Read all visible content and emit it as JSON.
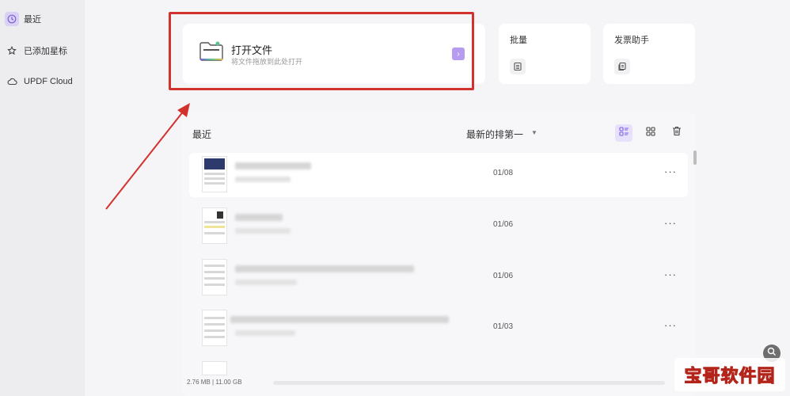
{
  "sidebar": {
    "items": [
      {
        "label": "最近",
        "icon": "clock-icon",
        "active": true
      },
      {
        "label": "已添加星标",
        "icon": "star-icon",
        "active": false
      },
      {
        "label": "UPDF Cloud",
        "icon": "cloud-icon",
        "active": false
      }
    ]
  },
  "top_cards": {
    "open_file": {
      "title": "打开文件",
      "subtitle": "将文件拖放到此处打开",
      "arrow": "›"
    },
    "batch": {
      "title": "批量"
    },
    "assistant": {
      "title": "发票助手"
    }
  },
  "recent": {
    "title": "最近",
    "sort_label": "最新的排第一",
    "sort_caret": "▼",
    "rows": [
      {
        "date": "01/08",
        "selected": true
      },
      {
        "date": "01/06",
        "selected": false
      },
      {
        "date": "01/06",
        "selected": false
      },
      {
        "date": "01/03",
        "selected": false
      }
    ],
    "more_glyph": "···"
  },
  "footer": {
    "storage_text": "2.76 MB | 11.00 GB"
  },
  "watermark": {
    "text": "宝哥软件园"
  },
  "colors": {
    "accent": "#7b5fe0",
    "highlight_red": "#d2322d"
  }
}
